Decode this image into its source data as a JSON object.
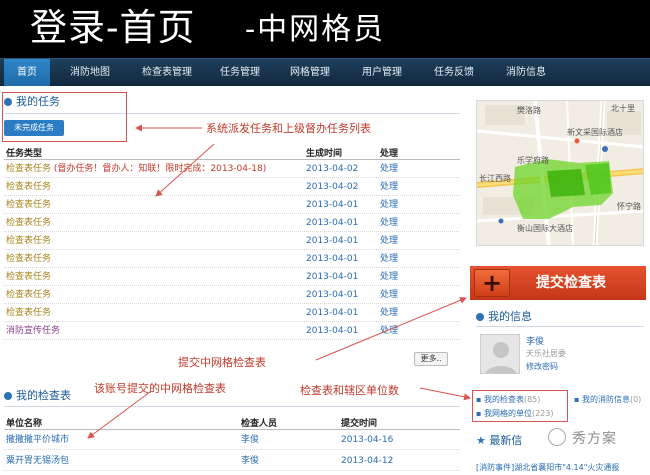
{
  "banner": {
    "title": "登录-首页",
    "subtitle": "-中网格员"
  },
  "nav": {
    "items": [
      "首页",
      "消防地图",
      "检查表管理",
      "任务管理",
      "网格管理",
      "用户管理",
      "任务反馈",
      "消防信息"
    ]
  },
  "tasks": {
    "title": "我的任务",
    "tab_label": "未完成任务",
    "headers": [
      "任务类型",
      "生成时间",
      "处理"
    ],
    "rows": [
      {
        "type": "检查表任务 (督办任务！督办人：知联！限时完成：2013-04-18)",
        "date": "2013-04-02",
        "action": "处理"
      },
      {
        "type": "检查表任务",
        "date": "2013-04-02",
        "action": "处理"
      },
      {
        "type": "检查表任务",
        "date": "2013-04-01",
        "action": "处理"
      },
      {
        "type": "检查表任务",
        "date": "2013-04-01",
        "action": "处理"
      },
      {
        "type": "检查表任务",
        "date": "2013-04-01",
        "action": "处理"
      },
      {
        "type": "检查表任务",
        "date": "2013-04-01",
        "action": "处理"
      },
      {
        "type": "检查表任务",
        "date": "2013-04-01",
        "action": "处理"
      },
      {
        "type": "检查表任务",
        "date": "2013-04-01",
        "action": "处理"
      },
      {
        "type": "检查表任务",
        "date": "2013-04-01",
        "action": "处理"
      },
      {
        "type": "消防宣传任务",
        "date": "2013-04-01",
        "action": "处理"
      }
    ],
    "more_label": "更多.."
  },
  "checks": {
    "title": "我的检查表",
    "headers": [
      "单位名称",
      "检查人员",
      "提交时间"
    ],
    "rows": [
      {
        "unit": "撒撒撒平价城市",
        "person": "李俊",
        "date": "2013-04-16"
      },
      {
        "unit": "粟开胃无锡汤包",
        "person": "李俊",
        "date": "2013-04-12"
      }
    ]
  },
  "annotations": {
    "a1": "系统派发任务和上级督办任务列表",
    "a2": "提交中网格检查表",
    "a3": "该账号提交的中网格检查表",
    "a4": "检查表和辖区单位数"
  },
  "map": {
    "labels": [
      "樊洛路",
      "北十里",
      "新文采国际酒店",
      "长江西路",
      "衡山国际大酒店",
      "怀宁路",
      "乐学府路"
    ],
    "highlight_color": "#6dd42a"
  },
  "submit": {
    "label": "提交检查表",
    "color": "#d9421f"
  },
  "info": {
    "title": "我的信息",
    "name": "李俊",
    "org": "天乐社居委",
    "change_password": "修改密码",
    "links": [
      {
        "label": "我的检查表",
        "count": "(85)"
      },
      {
        "label": "我的消防信息",
        "count": "(0)"
      },
      {
        "label": "我网格的单位",
        "count": "(223)"
      }
    ]
  },
  "latest": {
    "title": "最新信",
    "ticker": "[消防事件]湖北省襄阳市\"4.14\"火灾通报"
  },
  "watermark": {
    "text": "秀方案"
  }
}
